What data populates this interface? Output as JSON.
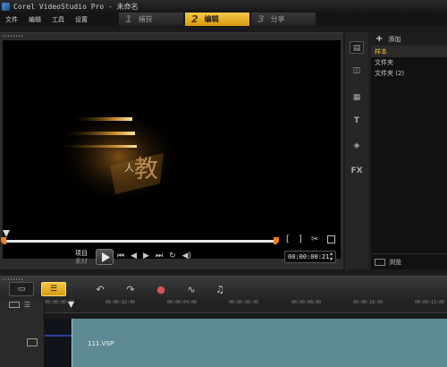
{
  "window": {
    "title": "Corel VideoStudio Pro - 未命名"
  },
  "menu": [
    "文件",
    "编辑",
    "工具",
    "设置"
  ],
  "steps": [
    {
      "num": "1",
      "label": "捕获",
      "active": false
    },
    {
      "num": "2",
      "label": "编辑",
      "active": true
    },
    {
      "num": "3",
      "label": "分享",
      "active": false
    }
  ],
  "preview": {
    "overlay_text": "教",
    "overlay_small": "人",
    "mode_project": "项目",
    "mode_clip": "素材",
    "mark_in": "[",
    "mark_out": "]",
    "timecode": "00:00:00:21"
  },
  "library": {
    "add_label": "添加",
    "folders": [
      "样本",
      "文件夹",
      "文件夹 (2)"
    ],
    "selected_folder": "样本",
    "browse_label": "浏览",
    "tool_text": "T",
    "tool_fx": "FX"
  },
  "timeline": {
    "ruler_ticks": [
      "00:00:00:00",
      "00:00:02:00",
      "00:00:04:00",
      "00:00:06:00",
      "00:00:08:00",
      "00:00:10:00",
      "00:00:12:00"
    ],
    "clip_label": "111.VSP"
  },
  "colors": {
    "accent": "#f0b429",
    "clip": "#5e8a95"
  }
}
